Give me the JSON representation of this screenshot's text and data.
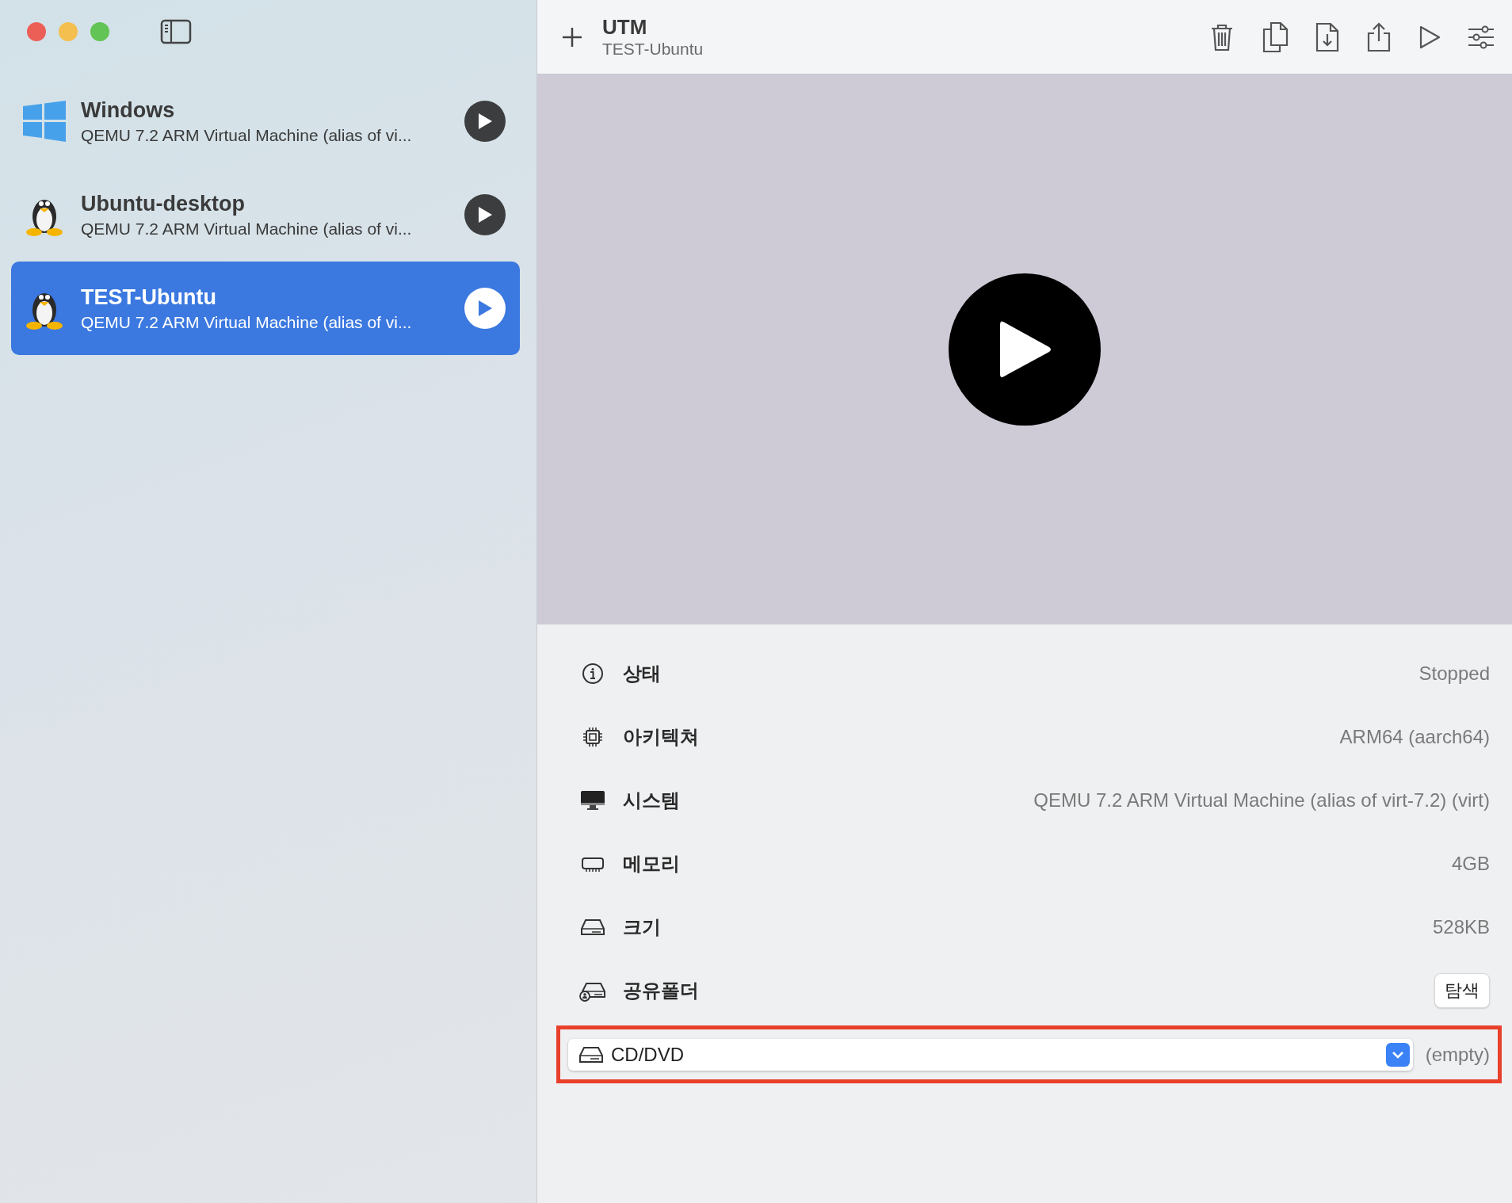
{
  "toolbar": {
    "title": "UTM",
    "subtitle": "TEST-Ubuntu"
  },
  "vms": [
    {
      "name": "Windows",
      "description": "QEMU 7.2 ARM Virtual Machine (alias of vi...",
      "selected": false
    },
    {
      "name": "Ubuntu-desktop",
      "description": "QEMU 7.2 ARM Virtual Machine (alias of vi...",
      "selected": false
    },
    {
      "name": "TEST-Ubuntu",
      "description": "QEMU 7.2 ARM Virtual Machine (alias of vi...",
      "selected": true
    }
  ],
  "details": [
    {
      "kind": "text",
      "label": "상태",
      "value": "Stopped"
    },
    {
      "kind": "text",
      "label": "아키텍쳐",
      "value": "ARM64 (aarch64)"
    },
    {
      "kind": "text",
      "label": "시스템",
      "value": "QEMU 7.2 ARM Virtual Machine (alias of virt-7.2) (virt)"
    },
    {
      "kind": "text",
      "label": "메모리",
      "value": "4GB"
    },
    {
      "kind": "text",
      "label": "크기",
      "value": "528KB"
    },
    {
      "kind": "button",
      "label": "공유폴더",
      "value": "탐색"
    }
  ],
  "drive": {
    "label": "CD/DVD",
    "value": "(empty)",
    "highlighted": true
  }
}
